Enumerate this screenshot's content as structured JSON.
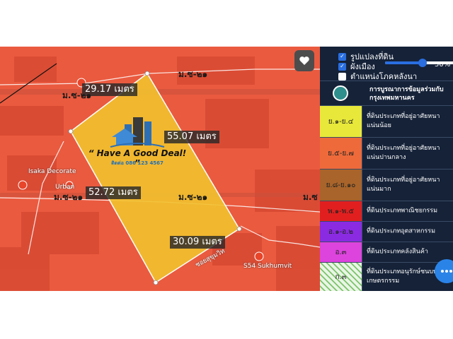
{
  "map": {
    "dimensions": [
      "29.17 เมตร",
      "55.07 เมตร",
      "52.72 เมตร",
      "30.09 เมตร"
    ],
    "roads": [
      "ม.ซ-๒๑",
      "ม.ซ-๒๑",
      "ม.ซ-๒๑",
      "ม.ซ-๒๑",
      "ม.ซ"
    ],
    "places": [
      "Isaka Decorate",
      "Urban",
      "S54 Sukhumvit",
      "ซอยสุขุมวิท"
    ],
    "logo": {
      "title": "“ Have A Good Deal! ”",
      "subtitle": "ติดต่อ 086 123 4567"
    },
    "parcel_color": "#f2c12e",
    "zone_color": "#ea5a3f"
  },
  "panel": {
    "layers": [
      {
        "label": "รูปแปลงที่ดิน",
        "checked": true
      },
      {
        "label": "ผังเมือง",
        "checked": true
      },
      {
        "label": "ตำแหน่งโภคหลังนา",
        "checked": false
      }
    ],
    "opacity": "50%",
    "opacity_value": 0.5,
    "legend_title": "การบูรณาการข้อมูลร่วมกับ กรุงเทพมหานคร",
    "legend": [
      {
        "code": "ย.๑-ย.๔",
        "desc": "ที่ดินประเภทที่อยู่อาศัยหนาแน่นน้อย",
        "color": "#e8e83a"
      },
      {
        "code": "ย.๕-ย.๗",
        "desc": "ที่ดินประเภทที่อยู่อาศัยหนาแน่นปานกลาง",
        "color": "#ee6a3a"
      },
      {
        "code": "ย.๘-ย.๑๐",
        "desc": "ที่ดินประเภทที่อยู่อาศัยหนาแน่นมาก",
        "color": "#a8642a"
      },
      {
        "code": "พ.๑-พ.๕",
        "desc": "ที่ดินประเภทพาณิชยกรรม",
        "color": "#e21f1f"
      },
      {
        "code": "อ.๑-อ.๒",
        "desc": "ที่ดินประเภทอุตสาหกรรม",
        "color": "#8a2be2"
      },
      {
        "code": "อ.๓",
        "desc": "ที่ดินประเภทคลังสินค้า",
        "color": "#dd44dd"
      },
      {
        "code": "ก.๓",
        "desc": "ที่ดินประเภทอนุรักษ์ชนบทและเกษตรกรรม",
        "color": "#e9f5e6"
      }
    ]
  }
}
